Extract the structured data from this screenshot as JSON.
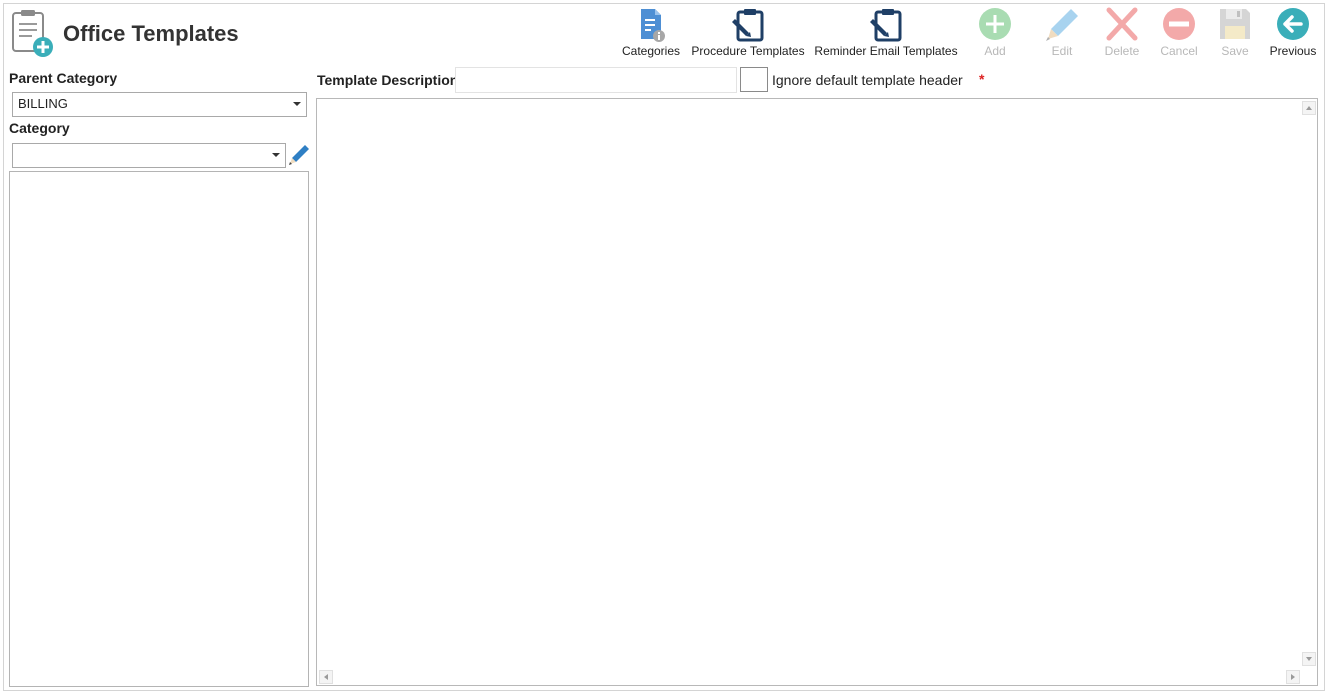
{
  "header": {
    "title": "Office Templates"
  },
  "toolbar": {
    "categories": "Categories",
    "procedure_templates": "Procedure Templates",
    "reminder_email_templates": "Reminder Email Templates",
    "add": "Add",
    "edit": "Edit",
    "delete": "Delete",
    "cancel": "Cancel",
    "save": "Save",
    "previous": "Previous"
  },
  "left": {
    "parent_category_label": "Parent Category",
    "parent_category_value": "BILLING",
    "category_label": "Category",
    "category_value": ""
  },
  "form": {
    "template_description_label": "Template Description",
    "template_description_value": "",
    "ignore_header_label": "Ignore default template header",
    "required_marker": "*"
  },
  "colors": {
    "accent_teal": "#3aaeb9",
    "navy": "#1f3f66",
    "disabled_green": "#a9dcb2",
    "disabled_red": "#f3a9a9",
    "disabled_blue": "#a8d3ef",
    "required_red": "#dd2222"
  }
}
